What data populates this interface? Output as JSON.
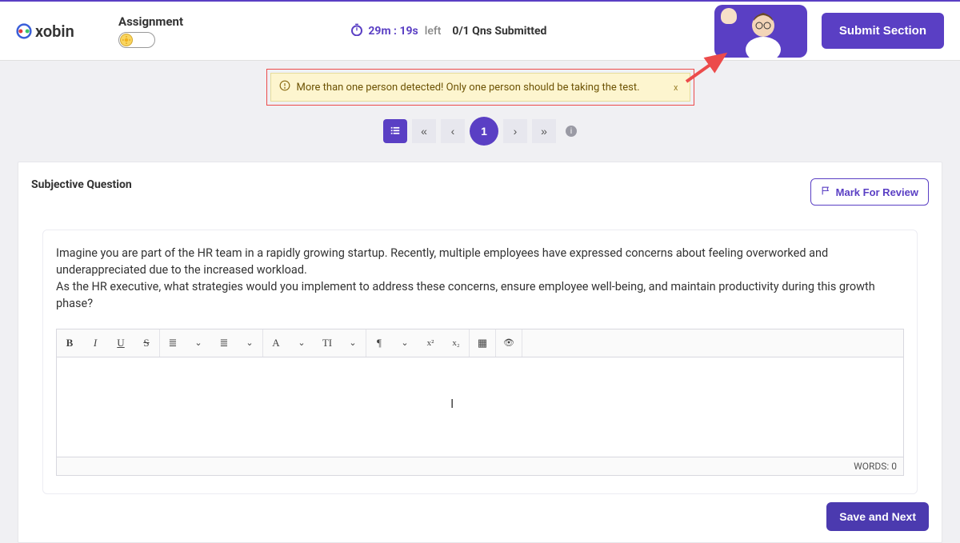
{
  "header": {
    "brand": "xobin",
    "title": "Assignment",
    "timer": "29m : 19s",
    "timer_suffix": "left",
    "qns_submitted": "0/1 Qns Submitted",
    "submit_label": "Submit Section"
  },
  "alert": {
    "message": "More than one person detected! Only one person should be taking the test.",
    "close": "x"
  },
  "pagination": {
    "first": "«",
    "prev": "‹",
    "page": "1",
    "next": "›",
    "last": "»",
    "info": "i"
  },
  "question": {
    "type_label": "Subjective Question",
    "mark_review_label": "Mark For Review",
    "para1": "Imagine you are part of the HR team in a rapidly growing startup. Recently, multiple employees have expressed concerns about feeling overworked and underappreciated due to the increased workload.",
    "para2": "As the HR executive, what strategies would you implement to address these concerns, ensure employee well-being, and maintain productivity during this growth phase?"
  },
  "editor": {
    "toolbar": {
      "bold": "B",
      "italic": "I",
      "underline": "U",
      "strike": "S",
      "ul": "≣",
      "ol": "≣",
      "font": "A",
      "size": "TI",
      "para": "¶",
      "sup": "x²",
      "sub": "x₂",
      "table": "▦",
      "preview": "👁",
      "drop": "⌄"
    },
    "words_label": "WORDS: 0",
    "save_next_label": "Save and Next"
  }
}
